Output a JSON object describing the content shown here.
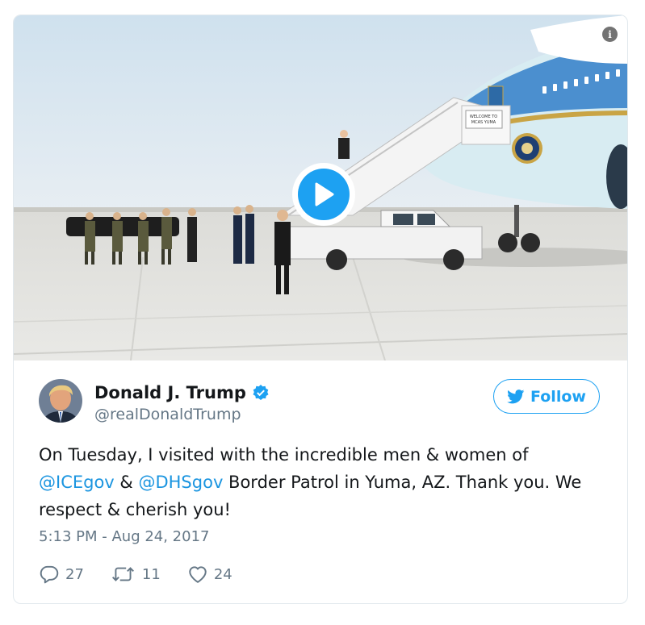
{
  "media": {
    "sign_line1": "WELCOME TO",
    "sign_line2": "MCAS YUMA",
    "info_icon": "info-icon",
    "play_icon": "play-icon"
  },
  "author": {
    "name": "Donald J. Trump",
    "handle": "@realDonaldTrump",
    "verified_icon": "verified-badge-icon"
  },
  "follow": {
    "label": "Follow",
    "icon": "twitter-bird-icon"
  },
  "tweet": {
    "text_1": "On Tuesday, I visited with the incredible men & women of",
    "mention_1": "@ICEgov",
    "text_2": " & ",
    "mention_2": "@DHSgov",
    "text_3": " Border Patrol in Yuma, AZ. Thank you. We respect & cherish you!",
    "timestamp": "5:13 PM - Aug 24, 2017"
  },
  "actions": {
    "replies": "27",
    "retweets": "11",
    "likes": "24"
  },
  "colors": {
    "accent": "#1da1f2",
    "mention": "#1b95e0",
    "secondary_text": "#657786"
  }
}
